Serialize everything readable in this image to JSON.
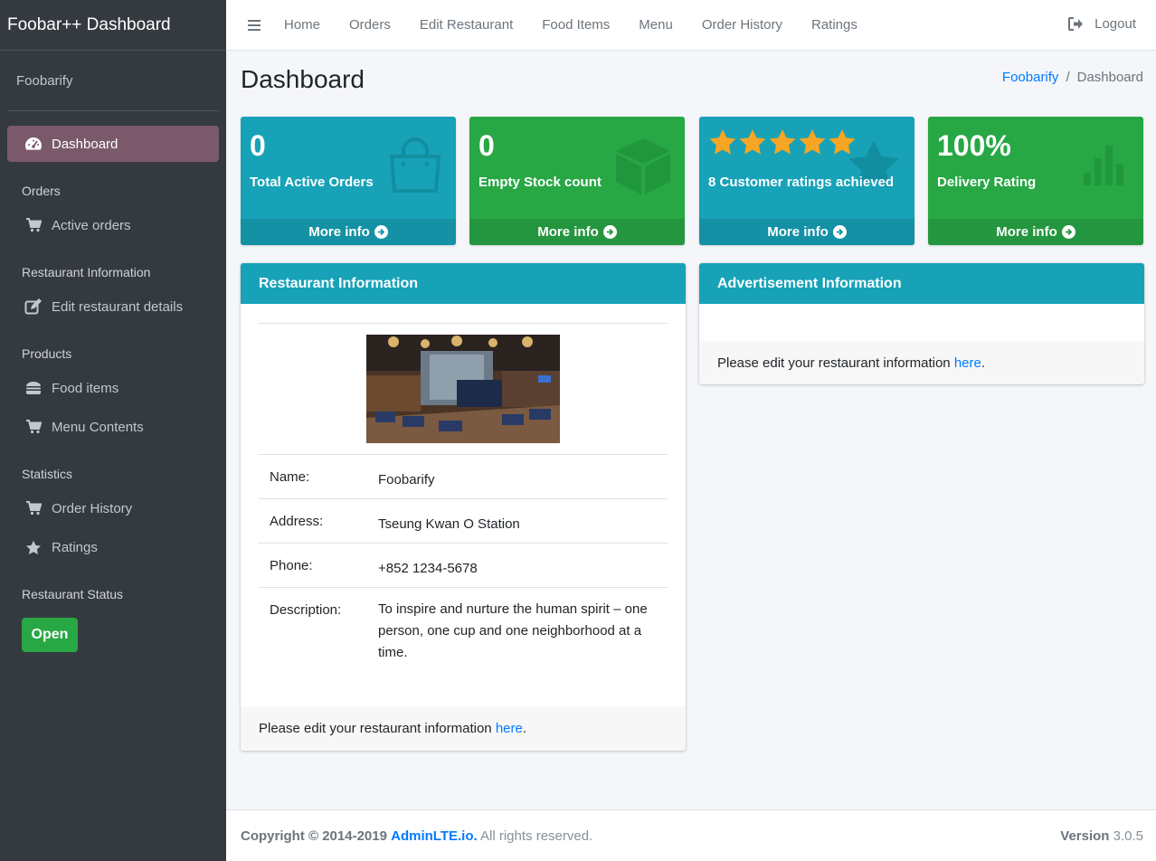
{
  "brand": {
    "title": "Foobar++ Dashboard"
  },
  "sidebar": {
    "user_name": "Foobarify",
    "items": [
      {
        "label": "Dashboard",
        "icon": "tachometer-icon"
      },
      {
        "header": "Orders"
      },
      {
        "label": "Active orders",
        "icon": "cart-icon"
      },
      {
        "header": "Restaurant Information"
      },
      {
        "label": "Edit restaurant details",
        "icon": "edit-icon"
      },
      {
        "header": "Products"
      },
      {
        "label": "Food items",
        "icon": "burger-icon"
      },
      {
        "label": "Menu Contents",
        "icon": "cart-icon"
      },
      {
        "header": "Statistics"
      },
      {
        "label": "Order History",
        "icon": "cart-icon"
      },
      {
        "label": "Ratings",
        "icon": "star-icon"
      },
      {
        "header": "Restaurant Status"
      }
    ],
    "status_button": "Open"
  },
  "topbar": {
    "links": [
      "Home",
      "Orders",
      "Edit Restaurant",
      "Food Items",
      "Menu",
      "Order History",
      "Ratings"
    ],
    "logout": "Logout"
  },
  "page": {
    "title": "Dashboard",
    "breadcrumb": [
      "Foobarify",
      "Dashboard"
    ]
  },
  "boxes": [
    {
      "value": "0",
      "label": "Total Active Orders",
      "more": "More info",
      "color": "#17a2b8",
      "icon": "shopping-bag-icon"
    },
    {
      "value": "0",
      "label": "Empty Stock count",
      "more": "More info",
      "color": "#28a745",
      "icon": "cube-icon"
    },
    {
      "value": "",
      "stars": 5,
      "label": "8 Customer ratings achieved",
      "more": "More info",
      "color": "#17a2b8",
      "icon": "star-icon"
    },
    {
      "value": "100%",
      "label": "Delivery Rating",
      "more": "More info",
      "color": "#28a745",
      "icon": "bar-chart-icon"
    }
  ],
  "restaurant_card": {
    "title": "Restaurant Information",
    "rows": [
      {
        "key": "Name:",
        "value": "Foobarify"
      },
      {
        "key": "Address:",
        "value": "Tseung Kwan O Station"
      },
      {
        "key": "Phone:",
        "value": "+852 1234-5678"
      },
      {
        "key": "Description:",
        "value": "To inspire and nurture the human spirit – one person, one cup and one neighborhood at a time."
      }
    ],
    "footer_text": "Please edit your restaurant information ",
    "footer_link": "here",
    "footer_end": "."
  },
  "ad_card": {
    "title": "Advertisement Information",
    "footer_text": "Please edit your restaurant information ",
    "footer_link": "here",
    "footer_end": "."
  },
  "footer": {
    "copyright": "Copyright © 2014-2019 ",
    "link": "AdminLTE.io.",
    "rights": " All rights reserved.",
    "version_label": "Version",
    "version": " 3.0.5"
  }
}
